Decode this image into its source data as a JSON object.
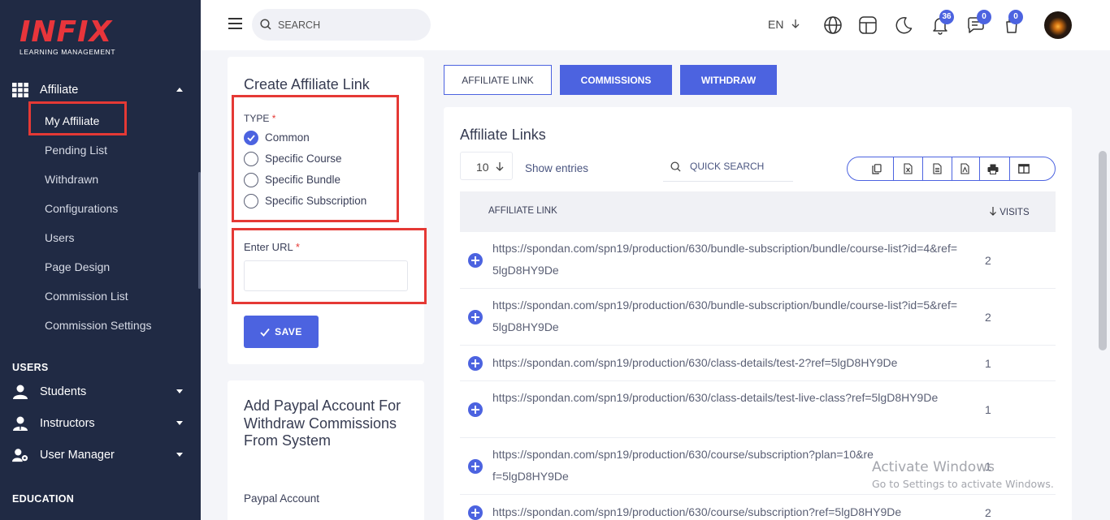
{
  "brand": {
    "logo_main": "INFIX",
    "logo_sub": "LEARNING MANAGEMENT",
    "accent": "#4c63e0",
    "highlight": "#e53935"
  },
  "sidebar": {
    "affiliate_header": "Affiliate",
    "affiliate_items": [
      "My Affiliate",
      "Pending List",
      "Withdrawn",
      "Configurations",
      "Users",
      "Page Design",
      "Commission List",
      "Commission Settings"
    ],
    "section_users": "USERS",
    "users_items": [
      "Students",
      "Instructors",
      "User Manager"
    ],
    "section_education": "EDUCATION"
  },
  "header": {
    "search_placeholder": "SEARCH",
    "language": "EN",
    "notification_count": "36",
    "message_count": "0",
    "cart_count": "0"
  },
  "create_link": {
    "title": "Create Affiliate Link",
    "type_label": "TYPE",
    "required_mark": "*",
    "options": [
      "Common",
      "Specific Course",
      "Specific Bundle",
      "Specific Subscription"
    ],
    "selected_index": 0,
    "url_label": "Enter URL",
    "url_value": "",
    "save_label": "SAVE"
  },
  "paypal": {
    "title": "Add Paypal Account For Withdraw Commissions From System",
    "account_label": "Paypal Account"
  },
  "tabs": [
    "AFFILIATE LINK",
    "COMMISSIONS",
    "WITHDRAW"
  ],
  "links_table": {
    "title": "Affiliate Links",
    "entries_value": "10",
    "show_entries": "Show entries",
    "quick_search_placeholder": "QUICK SEARCH",
    "col_link": "AFFILIATE LINK",
    "col_visits": "VISITS",
    "rows": [
      {
        "link": "https://spondan.com/spn19/production/630/bundle-subscription/bundle/course-list?id=4&ref=5lgD8HY9De",
        "visits": "2"
      },
      {
        "link": "https://spondan.com/spn19/production/630/bundle-subscription/bundle/course-list?id=5&ref=5lgD8HY9De",
        "visits": "2"
      },
      {
        "link": "https://spondan.com/spn19/production/630/class-details/test-2?ref=5lgD8HY9De",
        "visits": "1"
      },
      {
        "link": "https://spondan.com/spn19/production/630/class-details/test-live-class?ref=5lgD8HY9De",
        "visits": "1"
      },
      {
        "link": "https://spondan.com/spn19/production/630/course/subscription?plan=10&ref=5lgD8HY9De",
        "visits": "1"
      },
      {
        "link": "https://spondan.com/spn19/production/630/course/subscription?ref=5lgD8HY9De",
        "visits": "2"
      }
    ]
  },
  "watermark": {
    "line1": "Activate Windows",
    "line2": "Go to Settings to activate Windows."
  }
}
